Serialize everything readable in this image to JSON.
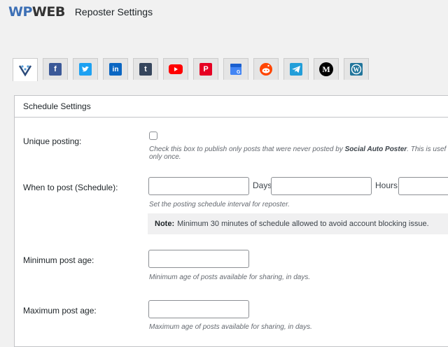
{
  "header": {
    "logo_wp": "WP",
    "logo_web": "WEB",
    "title": "Reposter Settings"
  },
  "tabs": [
    {
      "name": "general",
      "icon": "wpweb-logo-icon",
      "active": true,
      "color": "#ffffff"
    },
    {
      "name": "facebook",
      "icon": "facebook-icon",
      "glyph": "f",
      "color": "#3b5998"
    },
    {
      "name": "twitter",
      "icon": "twitter-icon",
      "glyph": "t",
      "color": "#1da1f2"
    },
    {
      "name": "linkedin",
      "icon": "linkedin-icon",
      "glyph": "in",
      "color": "#0a66c2"
    },
    {
      "name": "tumblr",
      "icon": "tumblr-icon",
      "glyph": "t",
      "color": "#36465d"
    },
    {
      "name": "youtube",
      "icon": "youtube-icon",
      "glyph": "▶",
      "color": "#ff0000"
    },
    {
      "name": "pinterest",
      "icon": "pinterest-icon",
      "glyph": "P",
      "color": "#e60023"
    },
    {
      "name": "google-my-business",
      "icon": "google-business-icon",
      "glyph": "G",
      "color": "#4285f4"
    },
    {
      "name": "reddit",
      "icon": "reddit-icon",
      "glyph": "r",
      "color": "#ff4500"
    },
    {
      "name": "telegram",
      "icon": "telegram-icon",
      "glyph": "➤",
      "color": "#229ed9"
    },
    {
      "name": "medium",
      "icon": "medium-icon",
      "glyph": "M",
      "color": "#000000"
    },
    {
      "name": "wordpress",
      "icon": "wordpress-icon",
      "glyph": "W",
      "color": "#21759b"
    }
  ],
  "panel": {
    "heading": "Schedule Settings",
    "unique_posting": {
      "label": "Unique posting:",
      "desc_pre": "Check this box to publish only posts that were never posted by ",
      "desc_bold": "Social Auto Poster",
      "desc_post": ". This is usef",
      "desc_line2": "only once."
    },
    "schedule": {
      "label": "When to post (Schedule):",
      "days_unit": "Days",
      "hours_unit": "Hours",
      "days_value": "",
      "hours_value": "",
      "minutes_value": "",
      "desc": "Set the posting schedule interval for reposter.",
      "note_label": "Note:",
      "note_text": "Minimum 30 minutes of schedule allowed to avoid account blocking issue."
    },
    "min_age": {
      "label": "Minimum post age:",
      "value": "",
      "desc": "Minimum age of posts available for sharing, in days."
    },
    "max_age": {
      "label": "Maximum post age:",
      "value": "",
      "desc": "Maximum age of posts available for sharing, in days."
    }
  }
}
